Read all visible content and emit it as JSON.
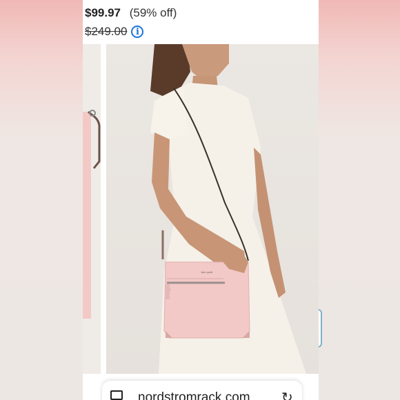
{
  "price": {
    "current": "$99.97",
    "discount": "(59% off)",
    "original": "$249.00"
  },
  "icons": {
    "info": "info-icon",
    "tabs": "tabs-icon",
    "reload": "reload-icon"
  },
  "browser": {
    "url": "nordstromrack.com"
  },
  "colors": {
    "bag": "#f2c9c7",
    "dress": "#f4efe6",
    "info": "#1a73d9"
  }
}
